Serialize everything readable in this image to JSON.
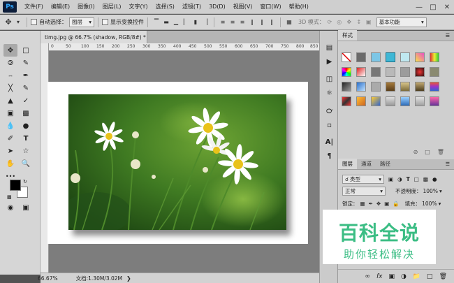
{
  "app": {
    "logo": "Ps",
    "menu": [
      "文件(F)",
      "编辑(E)",
      "图像(I)",
      "图层(L)",
      "文字(Y)",
      "选择(S)",
      "滤镜(T)",
      "3D(D)",
      "视图(V)",
      "窗口(W)",
      "帮助(H)"
    ]
  },
  "options": {
    "auto_select_label": "自动选择：",
    "auto_select_value": "图层",
    "show_transform_label": "显示变换控件",
    "mode_3d_label": "3D 模式：",
    "workspace": "基本功能"
  },
  "document": {
    "tab_title": "timg.jpg @ 66.7% (shadow, RGB/8#) *",
    "zoom": "66.67%",
    "doc_size": "文档:1.30M/3.02M"
  },
  "ruler": {
    "labels": [
      "0",
      "50",
      "100",
      "150",
      "200",
      "250",
      "300",
      "350",
      "400",
      "450",
      "500",
      "550",
      "600",
      "650",
      "700",
      "750",
      "800",
      "850"
    ]
  },
  "panels": {
    "styles_tab": "样式",
    "layers_tabs": [
      "图层",
      "通道",
      "路径"
    ],
    "kind_filter": "类型",
    "blend_mode": "正常",
    "opacity_label": "不透明度：",
    "opacity_value": "100%",
    "lock_label": "锁定：",
    "fill_label": "填充：",
    "fill_value": "100%"
  },
  "watermark": {
    "title": "百科全说",
    "subtitle": "助你轻松解决"
  },
  "colors": {
    "accent": "#3bbd84",
    "logo_bg": "#0d1d3a",
    "logo_fg": "#31a8ff"
  }
}
